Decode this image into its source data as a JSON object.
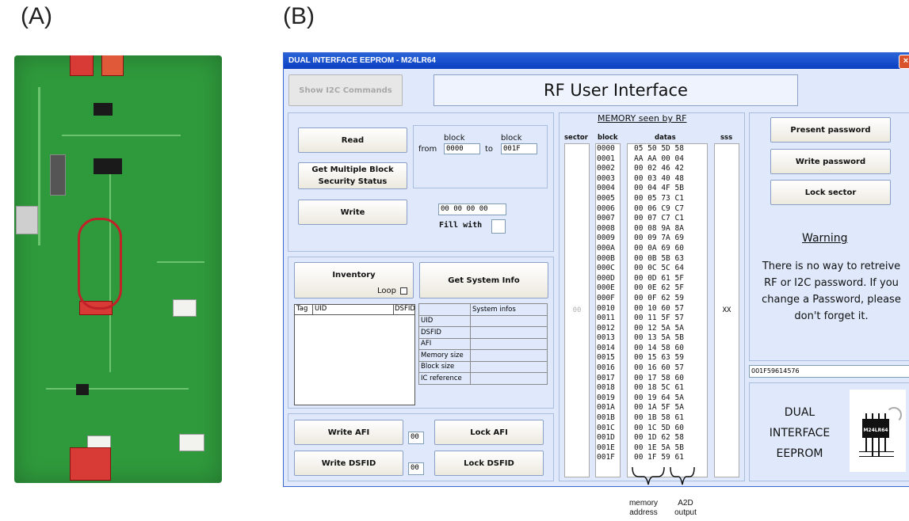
{
  "labels": {
    "a": "(A)",
    "b": "(B)"
  },
  "window": {
    "title": "DUAL INTERFACE EEPROM - M24LR64",
    "close": "×",
    "show_i2c": "Show I2C Commands",
    "heading": "RF User Interface"
  },
  "read_group": {
    "read": "Read",
    "get_multi": "Get Multiple Block Security Status",
    "write": "Write",
    "block_label_1": "block",
    "block_label_2": "block",
    "from": "from",
    "to": "to",
    "from_value": "0000",
    "to_value": "001F",
    "write_value": "00 00 00 00",
    "fill_with": "Fill with"
  },
  "inventory_group": {
    "inventory": "Inventory",
    "loop": "Loop",
    "get_sys_info": "Get System Info",
    "col_tag": "Tag",
    "col_uid": "UID",
    "col_dsfid": "DSFID",
    "sys_header": "System infos",
    "sys_rows": [
      "UID",
      "DSFID",
      "AFI",
      "Memory size",
      "Block size",
      "IC reference"
    ]
  },
  "afi_group": {
    "write_afi": "Write AFI",
    "afi_value": "00",
    "lock_afi": "Lock AFI",
    "write_dsfid": "Write DSFID",
    "dsfid_value": "00",
    "lock_dsfid": "Lock DSFID"
  },
  "memory": {
    "title": "MEMORY seen by RF",
    "col_sector": "sector",
    "col_block": "block",
    "col_datas": "datas",
    "col_sss": "sss",
    "sector_value": "00",
    "sss_value": "XX",
    "rows": [
      [
        "0000",
        "05 50 5D 58"
      ],
      [
        "0001",
        "AA AA 00 04"
      ],
      [
        "0002",
        "00 02 46 42"
      ],
      [
        "0003",
        "00 03 40 48"
      ],
      [
        "0004",
        "00 04 4F 5B"
      ],
      [
        "0005",
        "00 05 73 C1"
      ],
      [
        "0006",
        "00 06 C9 C7"
      ],
      [
        "0007",
        "00 07 C7 C1"
      ],
      [
        "0008",
        "00 08 9A 8A"
      ],
      [
        "0009",
        "00 09 7A 69"
      ],
      [
        "000A",
        "00 0A 69 60"
      ],
      [
        "000B",
        "00 0B 5B 63"
      ],
      [
        "000C",
        "00 0C 5C 64"
      ],
      [
        "000D",
        "00 0D 61 5F"
      ],
      [
        "000E",
        "00 0E 62 5F"
      ],
      [
        "000F",
        "00 0F 62 59"
      ],
      [
        "0010",
        "00 10 60 57"
      ],
      [
        "0011",
        "00 11 5F 57"
      ],
      [
        "0012",
        "00 12 5A 5A"
      ],
      [
        "0013",
        "00 13 5A 5B"
      ],
      [
        "0014",
        "00 14 58 60"
      ],
      [
        "0015",
        "00 15 63 59"
      ],
      [
        "0016",
        "00 16 60 57"
      ],
      [
        "0017",
        "00 17 58 60"
      ],
      [
        "0018",
        "00 18 5C 61"
      ],
      [
        "0019",
        "00 19 64 5A"
      ],
      [
        "001A",
        "00 1A 5F 5A"
      ],
      [
        "001B",
        "00 1B 58 61"
      ],
      [
        "001C",
        "00 1C 5D 60"
      ],
      [
        "001D",
        "00 1D 62 58"
      ],
      [
        "001E",
        "00 1E 5A 5B"
      ],
      [
        "001F",
        "00 1F 59 61"
      ]
    ]
  },
  "password_group": {
    "present": "Present password",
    "write": "Write password",
    "lock": "Lock sector",
    "warning_title": "Warning",
    "warning_text": "There is no way to retreive RF or I2C password. If you change a Password, please don't forget it.",
    "uid_value": "001F59614576",
    "brand_l1": "DUAL",
    "brand_l2": "INTERFACE",
    "brand_l3": "EEPROM",
    "chip_label": "M24LR64"
  },
  "annotations": {
    "memory_address_1": "memory",
    "memory_address_2": "address",
    "a2d_1": "A2D",
    "a2d_2": "output"
  },
  "colors": {
    "window_bg": "#dfe9fb",
    "titlebar": "#0a3fc2",
    "pcb": "#2f9a3c"
  }
}
